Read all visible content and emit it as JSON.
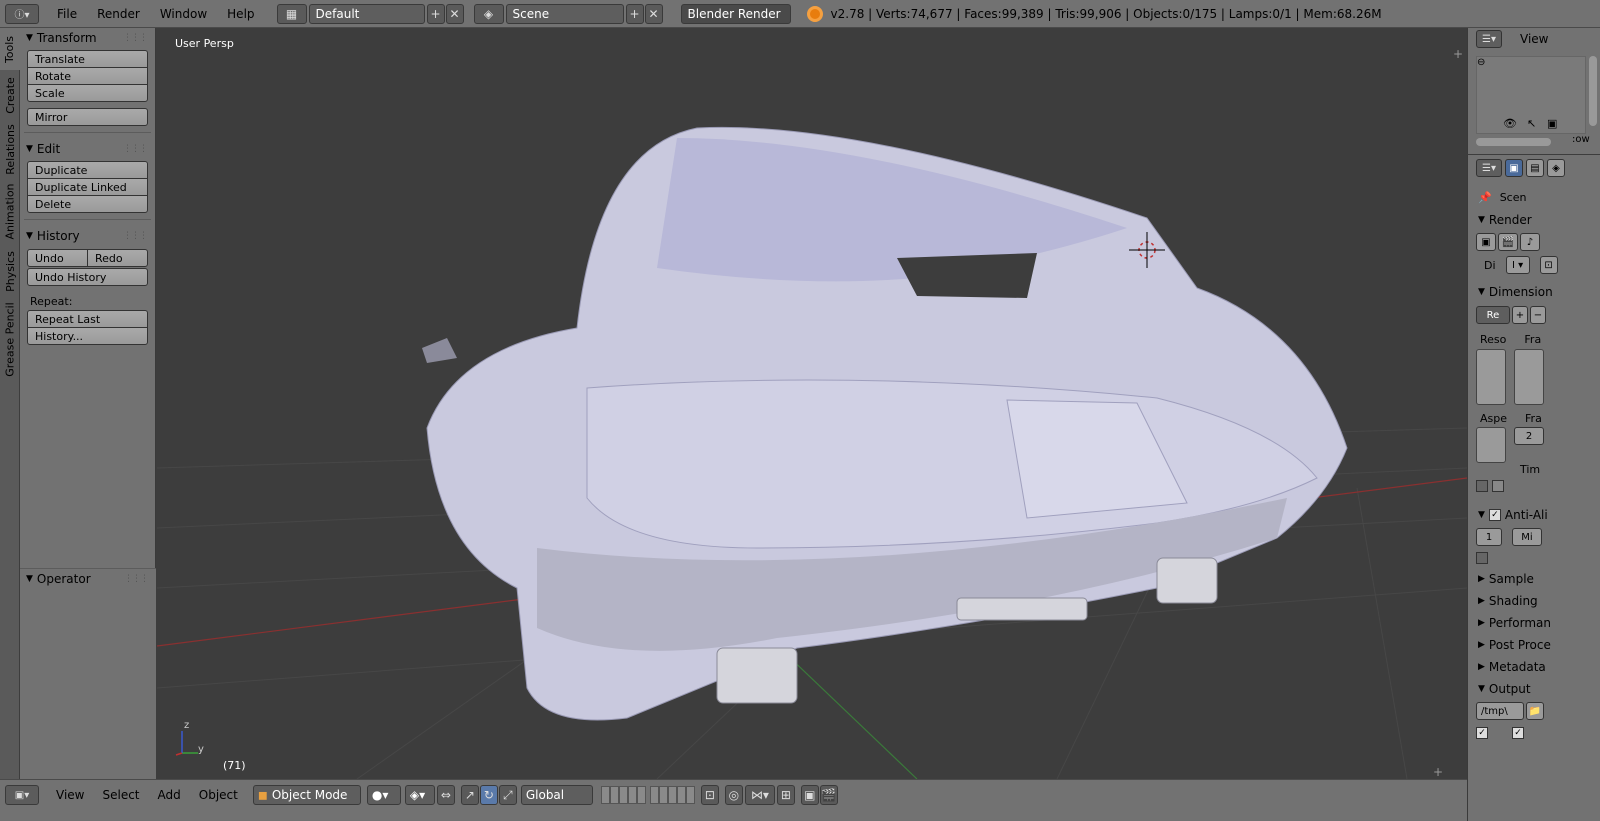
{
  "topbar": {
    "menus": [
      "File",
      "Render",
      "Window",
      "Help"
    ],
    "screen_layout": "Default",
    "scene": "Scene",
    "render_engine": "Blender Render",
    "stats": "v2.78 | Verts:74,677 | Faces:99,389 | Tris:99,906 | Objects:0/175 | Lamps:0/1 | Mem:68.26M"
  },
  "left_tabs": [
    "Tools",
    "Create",
    "Relations",
    "Animation",
    "Physics",
    "Grease Pencil"
  ],
  "toolshelf": {
    "transform": {
      "title": "Transform",
      "buttons": [
        "Translate",
        "Rotate",
        "Scale",
        "Mirror"
      ]
    },
    "edit": {
      "title": "Edit",
      "buttons": [
        "Duplicate",
        "Duplicate Linked",
        "Delete"
      ]
    },
    "history": {
      "title": "History",
      "undo": "Undo",
      "redo": "Redo",
      "undo_history": "Undo History",
      "repeat_label": "Repeat:",
      "repeat_last": "Repeat Last",
      "history_btn": "History..."
    },
    "operator": {
      "title": "Operator"
    }
  },
  "viewport": {
    "title": "User Persp",
    "frame": "(71)",
    "axis_x": "y",
    "axis_z": "z"
  },
  "outliner": {
    "view_label": "View",
    "row_label": ":ow"
  },
  "properties": {
    "scene_label": "Scen",
    "render": "Render",
    "di_label": "Di",
    "dimensions": "Dimension",
    "preset": "Re",
    "reso": "Reso",
    "fra": "Fra",
    "aspe": "Aspe",
    "fra2": "Fra",
    "fra2_value": "2",
    "tim": "Tim",
    "anti_alias": "Anti-Ali",
    "aa_value": "1",
    "aa_filter": "Mi",
    "sampled": "Sample",
    "shading": "Shading",
    "performance": "Performan",
    "post_processing": "Post Proce",
    "metadata": "Metadata",
    "output": "Output",
    "output_path": "/tmp\\"
  },
  "bottombar": {
    "menus": [
      "View",
      "Select",
      "Add",
      "Object"
    ],
    "mode": "Object Mode",
    "orientation": "Global"
  }
}
